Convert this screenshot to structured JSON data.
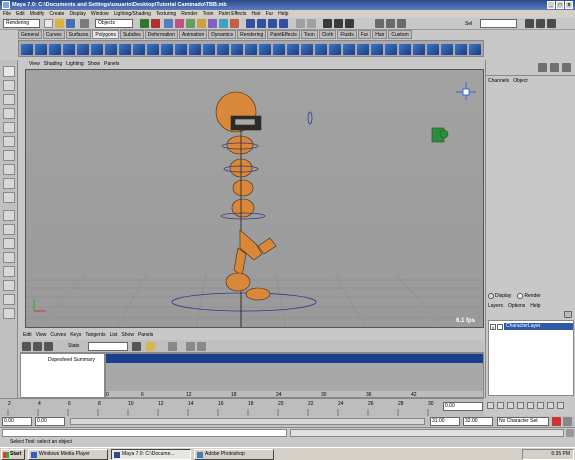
{
  "window": {
    "title": "Maya 7.0: C:\\Documents and Settings\\usuario\\Desktop\\Tutorial Caminado\\TBB.mb",
    "min_glyph": "_",
    "max_glyph": "□",
    "close_glyph": "x"
  },
  "menubar": [
    "File",
    "Edit",
    "Modify",
    "Create",
    "Display",
    "Window",
    "Lighting/Shading",
    "Texturing",
    "Render",
    "Toon",
    "Paint Effects",
    "Hair",
    "Fur",
    "Help"
  ],
  "statusline": {
    "mode": "Rendering",
    "selection_mask": "Objects",
    "sel_label": "Sel"
  },
  "shelf_tabs": [
    "General",
    "Curves",
    "Surfaces",
    "Polygons",
    "Subdivs",
    "Deformation",
    "Animation",
    "Dynamics",
    "Rendering",
    "PaintEffects",
    "Toon",
    "Cloth",
    "Fluids",
    "Fur",
    "Hair",
    "Custom"
  ],
  "active_shelf_tab": "Polygons",
  "panel_menu": [
    "View",
    "Shading",
    "Lighting",
    "Show",
    "Panels"
  ],
  "viewport": {
    "fps": "6.1 fps",
    "axis_x": "x",
    "axis_y": "y"
  },
  "channel_box": {
    "menu": [
      "Channels",
      "Object"
    ]
  },
  "layer_editor": {
    "mode_display": "Display",
    "mode_render": "Render",
    "menu": [
      "Layers",
      "Options",
      "Help"
    ],
    "layer_visibility": "V",
    "layer_name": "CharacterLayer"
  },
  "graph_menu": [
    "Edit",
    "View",
    "Curves",
    "Keys",
    "Tangents",
    "List",
    "Show",
    "Panels"
  ],
  "dopesheet": {
    "stats_label": "Stats",
    "outliner_item": "Dopesheet Summary",
    "ruler_ticks": [
      "0",
      "6",
      "12",
      "18",
      "24",
      "30",
      "36",
      "42"
    ]
  },
  "timeline": {
    "ticks": [
      "2",
      "4",
      "6",
      "8",
      "10",
      "12",
      "14",
      "16",
      "18",
      "20",
      "22",
      "24",
      "26",
      "28",
      "30"
    ],
    "current_time": "0.00"
  },
  "range": {
    "start": "0.00",
    "anim_start": "0.00",
    "range_end": "31.00",
    "anim_end": "32.00",
    "character_set": "No Character Set"
  },
  "help_line": "Select Tool: select an object",
  "taskbar": {
    "start": "Start",
    "items": [
      "Windows Media Player",
      "Maya 7.0: C:\\Docume...",
      "Adobe Photoshop"
    ],
    "active_item": 1,
    "clock": "6:35 PM"
  },
  "colors": {
    "title_bar": "#2c4a8c",
    "viewport_bg": "#9e9e9e",
    "character_orange": "#d9883a",
    "dopesheet_summary": "#1a3f8c"
  }
}
